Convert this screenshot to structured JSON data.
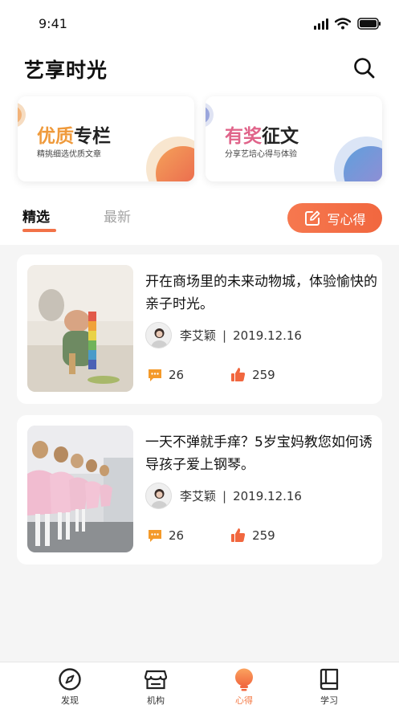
{
  "status_bar": {
    "time": "9:41"
  },
  "header": {
    "title": "艺享时光"
  },
  "features": [
    {
      "highlight": "优质",
      "rest": "专栏",
      "subtitle": "精挑细选优质文章",
      "accent": "#ef9a3c"
    },
    {
      "highlight": "有奖",
      "rest": "征文",
      "subtitle": "分享艺培心得与体验",
      "accent": "#e0648a"
    }
  ],
  "tabs": [
    {
      "label": "精选",
      "active": true
    },
    {
      "label": "最新",
      "active": false
    }
  ],
  "write_button": {
    "label": "写心得"
  },
  "articles": [
    {
      "title": "开在商场里的未来动物城，体验愉快的亲子时光。",
      "author": "李艾颖",
      "date": "2019.12.16",
      "comments": "26",
      "likes": "259"
    },
    {
      "title": "一天不弹就手痒？5岁宝妈教您如何诱导孩子爱上钢琴。",
      "author": "李艾颖",
      "date": "2019.12.16",
      "comments": "26",
      "likes": "259"
    }
  ],
  "bottom_nav": [
    {
      "label": "发现",
      "icon": "compass-icon",
      "active": false
    },
    {
      "label": "机构",
      "icon": "store-icon",
      "active": false
    },
    {
      "label": "心得",
      "icon": "bulb-icon",
      "active": true
    },
    {
      "label": "学习",
      "icon": "book-icon",
      "active": false
    }
  ],
  "colors": {
    "accent": "#f27248",
    "stat_icon": "#f49a2a",
    "like_icon": "#f1673f"
  }
}
